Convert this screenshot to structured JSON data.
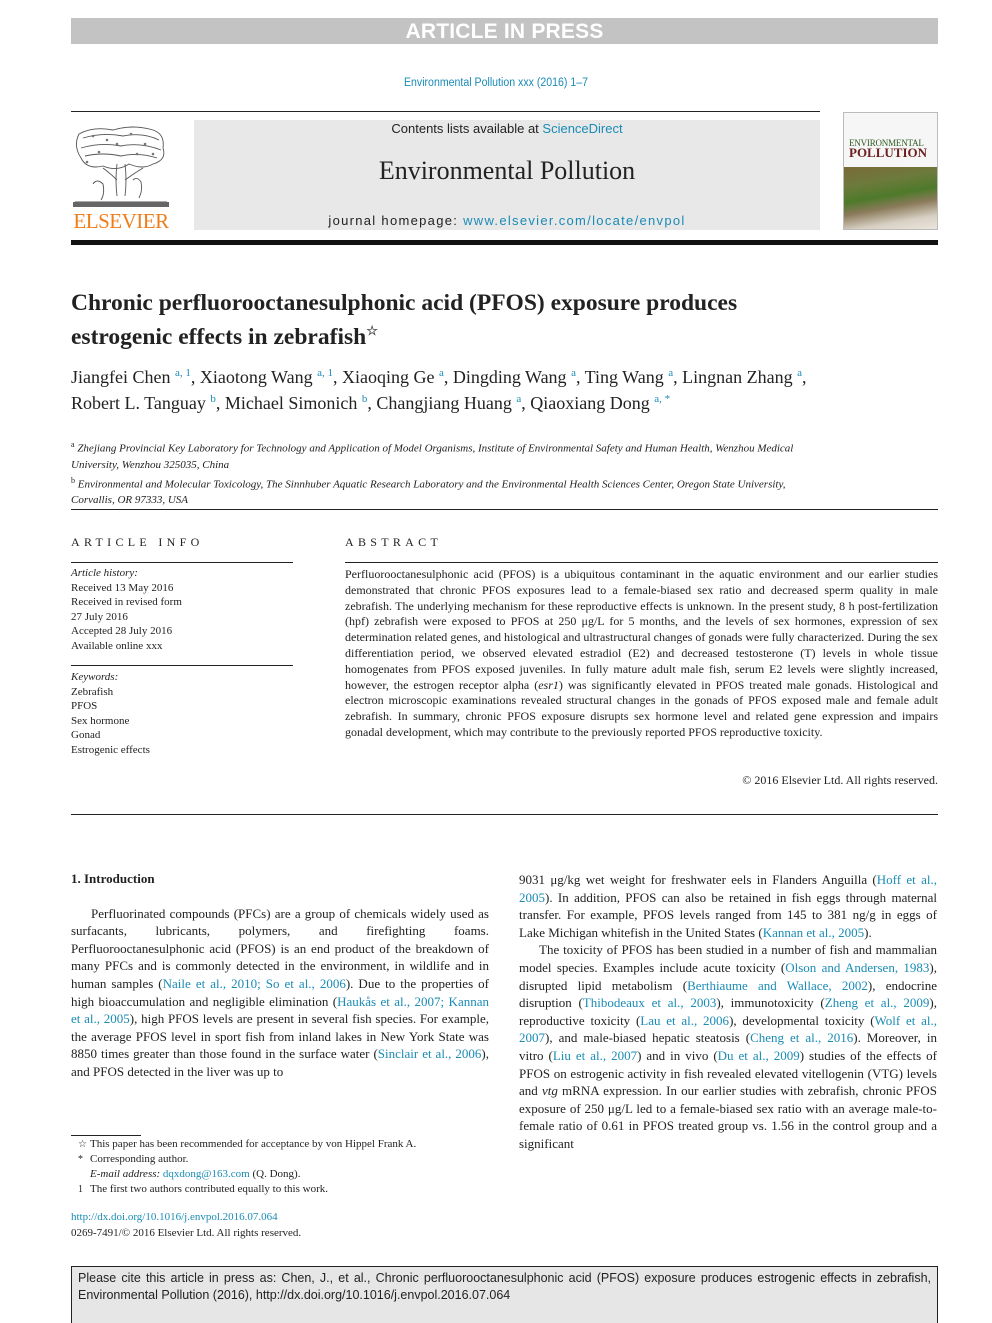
{
  "banner": {
    "label": "ARTICLE IN PRESS"
  },
  "journal_ref": "Environmental Pollution xxx (2016) 1–7",
  "masthead": {
    "contents_prefix": "Contents lists available at ",
    "contents_link": "ScienceDirect",
    "journal_name": "Environmental Pollution",
    "homepage_prefix": "journal homepage: ",
    "homepage_link": "www.elsevier.com/locate/envpol",
    "publisher": "ELSEVIER",
    "cover_title_line1": "ENVIRONMENTAL",
    "cover_title_line2": "POLLUTION"
  },
  "article": {
    "title": "Chronic perfluorooctanesulphonic acid (PFOS) exposure produces estrogenic effects in zebrafish",
    "title_mark": "☆",
    "authors": [
      {
        "name": "Jiangfei Chen",
        "sup": "a, 1",
        "sep": ", "
      },
      {
        "name": "Xiaotong Wang",
        "sup": "a, 1",
        "sep": ", "
      },
      {
        "name": "Xiaoqing Ge",
        "sup": "a",
        "sep": ", "
      },
      {
        "name": "Dingding Wang",
        "sup": "a",
        "sep": ", "
      },
      {
        "name": "Ting Wang",
        "sup": "a",
        "sep": ", "
      },
      {
        "name": "Lingnan Zhang",
        "sup": "a",
        "sep": ", "
      },
      {
        "name": "Robert L. Tanguay",
        "sup": "b",
        "sep": ", "
      },
      {
        "name": "Michael Simonich",
        "sup": "b",
        "sep": ", "
      },
      {
        "name": "Changjiang Huang",
        "sup": "a",
        "sep": ", "
      },
      {
        "name": "Qiaoxiang Dong",
        "sup": "a, *",
        "sep": ""
      }
    ],
    "affiliations": [
      {
        "mark": "a",
        "text": "Zhejiang Provincial Key Laboratory for Technology and Application of Model Organisms, Institute of Environmental Safety and Human Health, Wenzhou Medical University, Wenzhou 325035, China"
      },
      {
        "mark": "b",
        "text": "Environmental and Molecular Toxicology, The Sinnhuber Aquatic Research Laboratory and the Environmental Health Sciences Center, Oregon State University, Corvallis, OR 97333, USA"
      }
    ]
  },
  "article_info": {
    "heading": "ARTICLE INFO",
    "history_label": "Article history:",
    "history": [
      "Received 13 May 2016",
      "Received in revised form",
      "27 July 2016",
      "Accepted 28 July 2016",
      "Available online xxx"
    ],
    "keywords_label": "Keywords:",
    "keywords": [
      "Zebrafish",
      "PFOS",
      "Sex hormone",
      "Gonad",
      "Estrogenic effects"
    ]
  },
  "abstract": {
    "heading": "ABSTRACT",
    "part1": "Perfluorooctanesulphonic acid (PFOS) is a ubiquitous contaminant in the aquatic environment and our earlier studies demonstrated that chronic PFOS exposures lead to a female-biased sex ratio and decreased sperm quality in male zebrafish. The underlying mechanism for these reproductive effects is unknown. In the present study, 8 h post-fertilization (hpf) zebrafish were exposed to PFOS at 250 μg/L for 5 months, and the levels of sex hormones, expression of sex determination related genes, and histological and ultrastructural changes of gonads were fully characterized. During the sex differentiation period, we observed elevated estradiol (E2) and decreased testosterone (T) levels in whole tissue homogenates from PFOS exposed juveniles. In fully mature adult male fish, serum E2 levels were slightly increased, however, the estrogen receptor alpha (",
    "gene": "esr1",
    "part2": ") was significantly elevated in PFOS treated male gonads. Histological and electron microscopic examinations revealed structural changes in the gonads of PFOS exposed male and female adult zebrafish. In summary, chronic PFOS exposure disrupts sex hormone level and related gene expression and impairs gonadal development, which may contribute to the previously reported PFOS reproductive toxicity.",
    "copyright": "© 2016 Elsevier Ltd. All rights reserved."
  },
  "intro": {
    "heading": "1.  Introduction",
    "left": {
      "t1": "Perfluorinated compounds (PFCs) are a group of chemicals widely used as surfacants, lubricants, polymers, and firefighting foams. Perfluorooctanesulphonic acid (PFOS) is an end product of the breakdown of many PFCs and is commonly detected in the environment, in wildlife and in human samples (",
      "c1": "Naile et al., 2010; So et al., 2006",
      "t2": "). Due to the properties of high bioaccumulation and negligible elimination (",
      "c2": "Haukås et al., 2007; Kannan et al., 2005",
      "t3": "), high PFOS levels are present in several fish species. For example, the average PFOS level in sport fish from inland lakes in New York State was 8850 times greater than those found in the surface water (",
      "c3": "Sinclair et al., 2006",
      "t4": "), and PFOS detected in the liver was up to"
    },
    "right": {
      "t1": "9031 μg/kg wet weight for freshwater eels in Flanders Anguilla (",
      "c1": "Hoff et al., 2005",
      "t2": "). In addition, PFOS can also be retained in fish eggs through maternal transfer. For example, PFOS levels ranged from 145 to 381 ng/g in eggs of Lake Michigan whitefish in the United States (",
      "c2": "Kannan et al., 2005",
      "t3": ").",
      "p2_t1": "The toxicity of PFOS has been studied in a number of fish and mammalian model species. Examples include acute toxicity (",
      "p2_c1": "Olson and Andersen, 1983",
      "p2_t2": "), disrupted lipid metabolism (",
      "p2_c2": "Berthiaume and Wallace, 2002",
      "p2_t3": "), endocrine disruption (",
      "p2_c3": "Thibodeaux et al., 2003",
      "p2_t4": "), immunotoxicity (",
      "p2_c4": "Zheng et al., 2009",
      "p2_t5": "), reproductive toxicity (",
      "p2_c5": "Lau et al., 2006",
      "p2_t6": "), developmental toxicity (",
      "p2_c6": "Wolf et al., 2007",
      "p2_t7": "), and male-biased hepatic steatosis (",
      "p2_c7": "Cheng et al., 2016",
      "p2_t8": "). Moreover, in vitro (",
      "p2_c8": "Liu et al., 2007",
      "p2_t9": ") and in vivo (",
      "p2_c9": "Du et al., 2009",
      "p2_t10": ") studies of the effects of PFOS on estrogenic activity in fish revealed elevated vitellogenin (VTG) levels and ",
      "p2_gene": "vtg",
      "p2_t11": " mRNA expression. In our earlier studies with zebrafish, chronic PFOS exposure of 250 μg/L led to a female-biased sex ratio with an average male-to-female ratio of 0.61 in PFOS treated group vs. 1.56 in the control group and a significant"
    }
  },
  "footnotes": {
    "star_mark": "☆",
    "star_text": "This paper has been recommended for acceptance by von Hippel Frank A.",
    "corr_mark": "*",
    "corr_text": "Corresponding author.",
    "email_label": "E-mail address: ",
    "email": "dqxdong@163.com",
    "email_suffix": " (Q. Dong).",
    "one_mark": "1",
    "one_text": "The first two authors contributed equally to this work."
  },
  "doi": {
    "link": "http://dx.doi.org/10.1016/j.envpol.2016.07.064",
    "issn": "0269-7491/© 2016 Elsevier Ltd. All rights reserved."
  },
  "cite_box": {
    "text": "Please cite this article in press as: Chen, J., et al., Chronic perfluorooctanesulphonic acid (PFOS) exposure produces estrogenic effects in zebrafish, Environmental Pollution (2016), http://dx.doi.org/10.1016/j.envpol.2016.07.064"
  }
}
